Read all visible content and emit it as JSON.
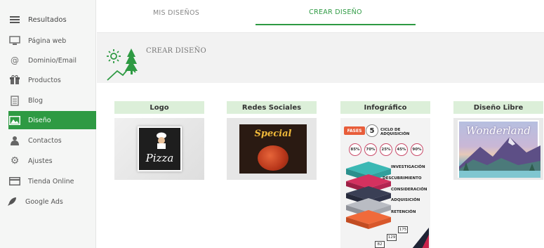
{
  "sidebar": {
    "header": "Resultados",
    "items": [
      {
        "label": "Página web",
        "icon": "monitor-icon"
      },
      {
        "label": "Dominio/Email",
        "icon": "at-sign-icon"
      },
      {
        "label": "Productos",
        "icon": "gift-icon"
      },
      {
        "label": "Blog",
        "icon": "document-icon"
      },
      {
        "label": "Diseño",
        "icon": "image-icon",
        "active": true
      },
      {
        "label": "Contactos",
        "icon": "person-icon"
      },
      {
        "label": "Ajustes",
        "icon": "gear-icon"
      },
      {
        "label": "Tienda Online",
        "icon": "card-icon"
      },
      {
        "label": "Google Ads",
        "icon": "rocket-icon"
      }
    ]
  },
  "tabs": [
    {
      "label": "MIS DISEÑOS",
      "active": false
    },
    {
      "label": "CREAR DISEÑO",
      "active": true
    }
  ],
  "section": {
    "title": "CREAR DISEÑO"
  },
  "cards": [
    {
      "label": "Logo",
      "thumb_text": "Pizza"
    },
    {
      "label": "Redes Sociales",
      "thumb_text": "Special"
    },
    {
      "label": "Infográfico",
      "fases_tag": "FASES",
      "fases_num": "5",
      "fases_text": "CICLO DE ADQUISICIÓN",
      "percentages": [
        "85%",
        "70%",
        "25%",
        "45%",
        "90%"
      ],
      "layers": [
        "INVESTIGACIÓN",
        "DESCUBRIMIENTO",
        "CONSIDERACIÓN",
        "ADQUISICIÓN",
        "RETENCIÓN"
      ],
      "numbers": [
        "175",
        "129",
        "82"
      ]
    },
    {
      "label": "Diseño Libre",
      "thumb_text": "Wonderland"
    }
  ],
  "colors": {
    "accent": "#2e9a43",
    "card_label_bg": "#dcefd9",
    "sidebar_bg": "#f5f6f5"
  }
}
